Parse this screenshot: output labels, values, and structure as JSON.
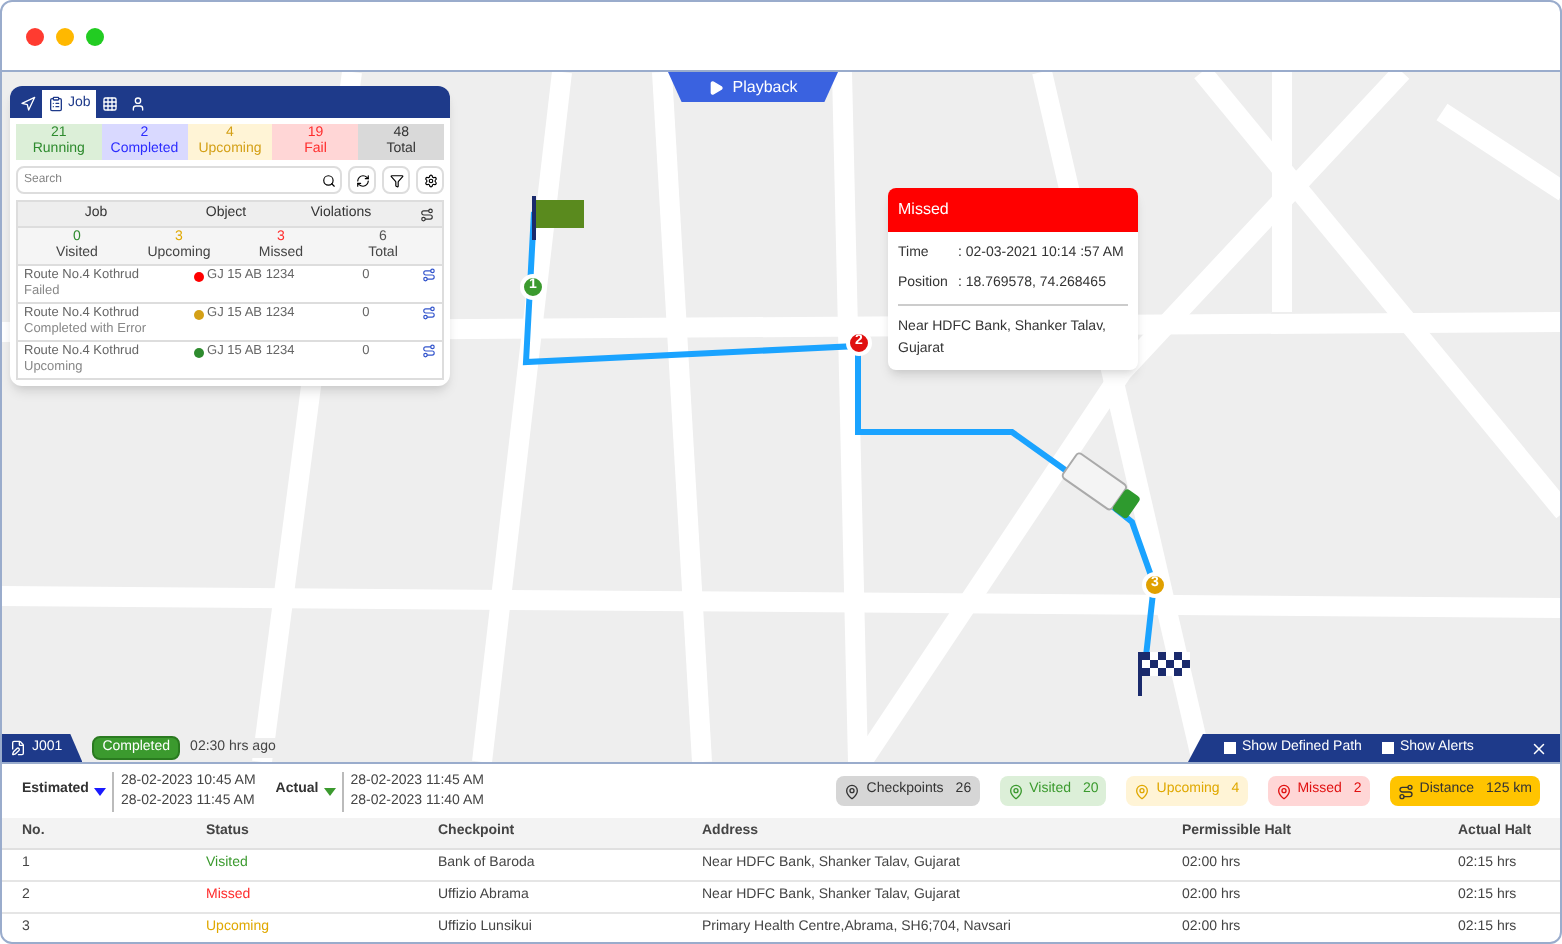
{
  "window": {
    "controls": [
      {
        "color": "#ff3b30"
      },
      {
        "color": "#ffb800"
      },
      {
        "color": "#22cc22"
      }
    ]
  },
  "playback": {
    "label": "Playback"
  },
  "job_panel": {
    "tabs": [
      {
        "kind": "navigate",
        "selected": false
      },
      {
        "kind": "job",
        "label": "Job",
        "selected": true
      },
      {
        "kind": "grid",
        "selected": false
      },
      {
        "kind": "user",
        "selected": false
      }
    ],
    "summary": [
      {
        "count": "21",
        "label": "Running",
        "color": "#2e8b2e"
      },
      {
        "count": "2",
        "label": "Completed",
        "color": "#2b2bff"
      },
      {
        "count": "4",
        "label": "Upcoming",
        "color": "#d4a017"
      },
      {
        "count": "19",
        "label": "Fail",
        "color": "#ff2b2b"
      },
      {
        "count": "48",
        "label": "Total",
        "color": "#333333"
      }
    ],
    "search": {
      "placeholder": "Search"
    },
    "columns": [
      "Job",
      "Object",
      "Violations"
    ],
    "stats": [
      {
        "count": "0",
        "label": "Visited",
        "color": "#2e8b2e"
      },
      {
        "count": "3",
        "label": "Upcoming",
        "color": "#e0a800"
      },
      {
        "count": "3",
        "label": "Missed",
        "color": "#ff2b2b"
      },
      {
        "count": "6",
        "label": "Total",
        "color": "#555555"
      }
    ],
    "rows": [
      {
        "route": "Route No.4 Kothrud",
        "status": "Failed",
        "object": "GJ 15 AB 1234",
        "color": "#ff0000",
        "violations": "0"
      },
      {
        "route": "Route No.4 Kothrud",
        "status": "Completed with Error",
        "object": "GJ 15 AB 1234",
        "color": "#d4a017",
        "violations": "0"
      },
      {
        "route": "Route No.4 Kothrud",
        "status": "Upcoming",
        "object": "GJ 15 AB 1234",
        "color": "#2e8b2e",
        "violations": "0"
      }
    ]
  },
  "map": {
    "markers": [
      {
        "number": "1",
        "color": "#3b9a2e"
      },
      {
        "number": "2",
        "color": "#e01010"
      },
      {
        "number": "3",
        "color": "#e0a000"
      }
    ],
    "popup": {
      "title": "Missed",
      "fields": [
        {
          "label": "Time",
          "value": ": 02-03-2021 10:14 :57 AM"
        },
        {
          "label": "Position",
          "value": ": 18.769578, 74.268465"
        }
      ],
      "address": "Near HDFC Bank, Shanker Talav, Gujarat"
    }
  },
  "trip": {
    "tab": "J001",
    "badge": "Completed",
    "ago": "02:30 hrs ago",
    "options": [
      {
        "label": "Show Defined Path",
        "checked": false
      },
      {
        "label": "Show Alerts",
        "checked": false
      }
    ],
    "schedule": [
      {
        "label": "Estimated",
        "color": "#1a1aff",
        "times": [
          "28-02-2023 10:45 AM",
          "28-02-2023 11:45 AM"
        ]
      },
      {
        "label": "Actual",
        "color": "#3b9a2e",
        "times": [
          "28-02-2023 11:45 AM",
          "28-02-2023 11:40 AM"
        ]
      }
    ],
    "chips": [
      {
        "kind": "checkpoints",
        "label": "Checkpoints",
        "count": "26"
      },
      {
        "kind": "visited",
        "label": "Visited",
        "count": "20"
      },
      {
        "kind": "upcoming",
        "label": "Upcoming",
        "count": "4"
      },
      {
        "kind": "missed",
        "label": "Missed",
        "count": "2"
      },
      {
        "kind": "distance",
        "label": "Distance",
        "count": "125 km"
      }
    ],
    "columns": [
      "No.",
      "Status",
      "Checkpoint",
      "Address",
      "Permissible Halt",
      "Actual Halt"
    ],
    "rows": [
      {
        "no": "1",
        "status": "Visited",
        "kind": "visited",
        "checkpoint": "Bank of Baroda",
        "address": "Near HDFC Bank, Shanker Talav, Gujarat",
        "permissible": "02:00 hrs",
        "actual": "02:15 hrs"
      },
      {
        "no": "2",
        "status": "Missed",
        "kind": "missed",
        "checkpoint": "Uffizio Abrama",
        "address": "Near HDFC Bank, Shanker Talav, Gujarat",
        "permissible": "02:00 hrs",
        "actual": "02:15 hrs"
      },
      {
        "no": "3",
        "status": "Upcoming",
        "kind": "upcoming",
        "checkpoint": "Uffizio Lunsikui",
        "address": "Primary Health Centre,Abrama, SH6;704, Navsari",
        "permissible": "02:00 hrs",
        "actual": "02:15 hrs"
      }
    ]
  }
}
